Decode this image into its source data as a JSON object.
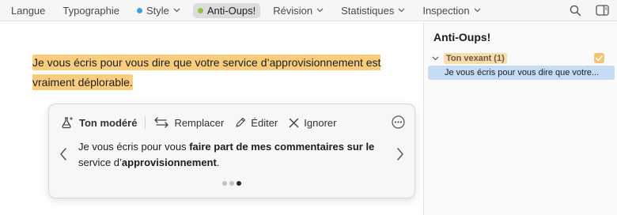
{
  "toolbar": {
    "items": [
      {
        "label": "Langue",
        "has_dot": false,
        "has_chevron": false
      },
      {
        "label": "Typographie",
        "has_dot": false,
        "has_chevron": false
      },
      {
        "label": "Style",
        "has_dot": true,
        "dot_color": "#3aa0e8",
        "has_chevron": true
      },
      {
        "label": "Anti-Oups!",
        "has_dot": true,
        "dot_color": "#8cc63f",
        "has_chevron": false,
        "active": true
      },
      {
        "label": "Révision",
        "has_dot": false,
        "has_chevron": true
      },
      {
        "label": "Statistiques",
        "has_dot": false,
        "has_chevron": true
      },
      {
        "label": "Inspection",
        "has_dot": false,
        "has_chevron": true
      }
    ],
    "right_icons": [
      "search-icon",
      "sidebar-toggle-icon"
    ]
  },
  "document": {
    "text": "Je vous écris pour vous dire que votre service d’approvisionnement est vraiment déplorable.",
    "highlight_color": "#f9cd7c"
  },
  "popover": {
    "tone_label": "Ton modéré",
    "replace_label": "Remplacer",
    "edit_label": "Éditer",
    "ignore_label": "Ignorer",
    "suggestion": {
      "part1": "Je vous écris pour vous ",
      "part2": "faire part de mes commentaires sur le",
      "part3": " service d’",
      "part4": "approvisionnement",
      "part5": "."
    },
    "page_count": 3,
    "current_page": 3
  },
  "sidebar": {
    "title": "Anti-Oups!",
    "group_label": "Ton vexant (1)",
    "group_color": "#f7dcae",
    "item_text": "Je vous écris pour vous dire que votre...",
    "item_color": "#c5dcf5"
  }
}
